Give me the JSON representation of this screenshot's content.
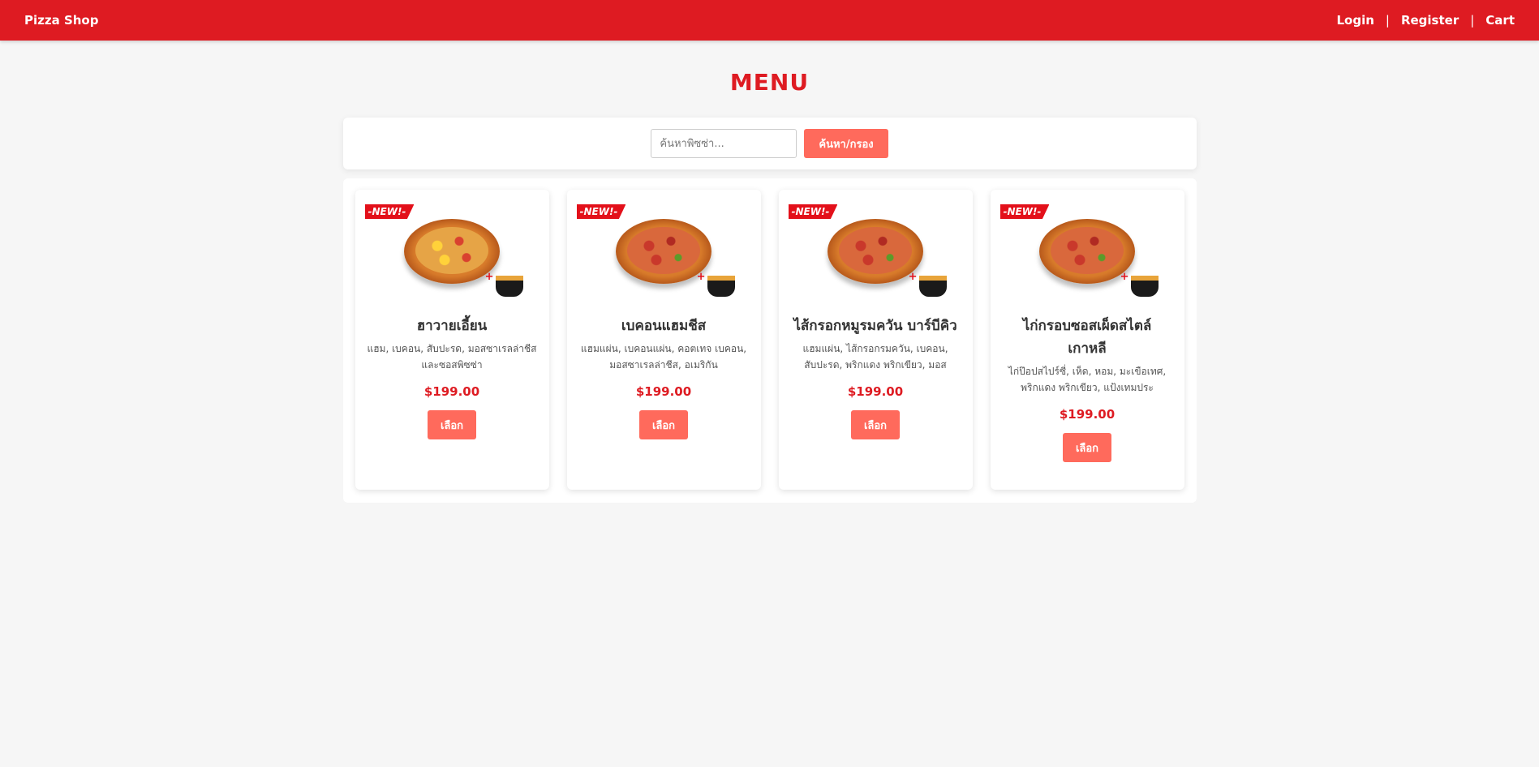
{
  "nav": {
    "brand": "Pizza Shop",
    "links": [
      "Login",
      "Register",
      "Cart"
    ],
    "separator": "|"
  },
  "page": {
    "title": "MENU"
  },
  "search": {
    "placeholder": "ค้นหาพิซซ่า...",
    "value": "",
    "button_label": "ค้นหา/กรอง"
  },
  "colors": {
    "primary": "#de1b22",
    "button": "#ff6a5c",
    "background": "#f6f6f6"
  },
  "products": [
    {
      "badge": "-NEW!-",
      "name": "ฮาวายเอี้ยน",
      "description": "แฮม, เบคอน, สับปะรด, มอสซาเรลล่าชีส และซอสพิซซ่า",
      "price": "$199.00",
      "button_label": "เลือก"
    },
    {
      "badge": "-NEW!-",
      "name": "เบคอนแฮมชีส",
      "description": "แฮมแผ่น, เบคอนแผ่น, คอตเทจ เบคอน, มอสซาเรลล่าชีส, อเมริกัน",
      "price": "$199.00",
      "button_label": "เลือก"
    },
    {
      "badge": "-NEW!-",
      "name": "ไส้กรอกหมูรมควัน บาร์บีคิว",
      "description": "แฮมแผ่น, ไส้กรอกรมควัน, เบคอน, สับปะรด, พริกแดง พริกเขียว, มอส",
      "price": "$199.00",
      "button_label": "เลือก"
    },
    {
      "badge": "-NEW!-",
      "name": "ไก่กรอบซอสเผ็ดสไตล์ เกาหลี",
      "description": "ไก่ป๊อปสไปร์ซี่, เห็ด, หอม, มะเขือเทศ, พริกแดง พริกเขียว, แป้งเทมประ",
      "price": "$199.00",
      "button_label": "เลือก"
    }
  ]
}
